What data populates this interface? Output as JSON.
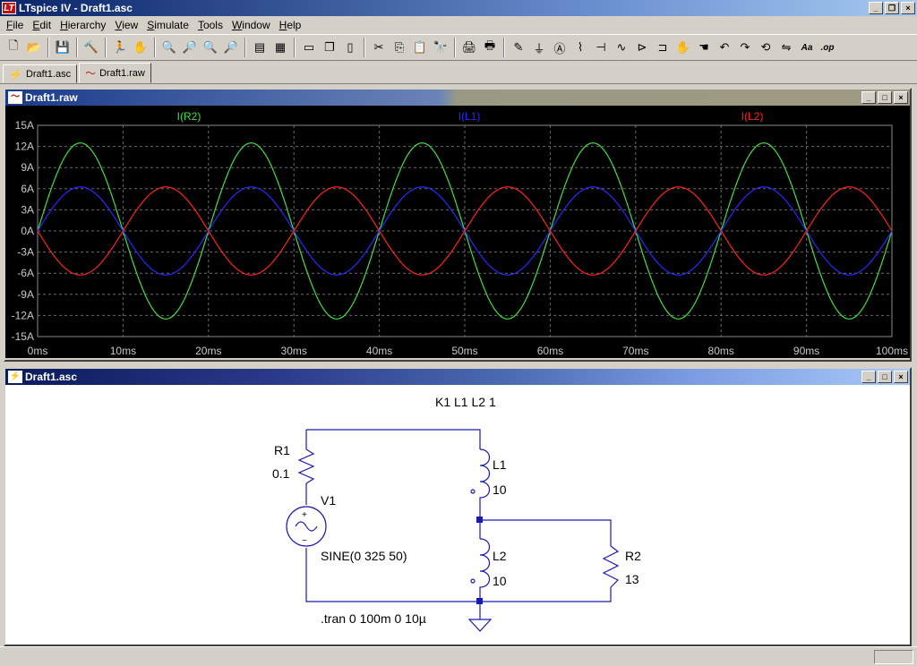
{
  "app": {
    "title": "LTspice IV - Draft1.asc",
    "icon_name": "ltspice-logo-icon"
  },
  "window_controls": [
    "_",
    "❐",
    "×"
  ],
  "menu": [
    {
      "label": "File",
      "ul": "F",
      "rest": "ile"
    },
    {
      "label": "Edit",
      "ul": "E",
      "rest": "dit"
    },
    {
      "label": "Hierarchy",
      "ul": "H",
      "rest": "ierarchy"
    },
    {
      "label": "View",
      "ul": "V",
      "rest": "iew"
    },
    {
      "label": "Simulate",
      "ul": "S",
      "rest": "imulate"
    },
    {
      "label": "Tools",
      "ul": "T",
      "rest": "ools"
    },
    {
      "label": "Window",
      "ul": "W",
      "rest": "indow"
    },
    {
      "label": "Help",
      "ul": "H",
      "rest": "elp"
    }
  ],
  "toolbar": [
    {
      "icon": "new-schematic-icon",
      "glyph": "🗋"
    },
    {
      "icon": "open-icon",
      "glyph": "📂"
    },
    {
      "sep": true
    },
    {
      "icon": "save-icon",
      "glyph": "💾"
    },
    {
      "sep": true
    },
    {
      "icon": "control-panel-icon",
      "glyph": "🔨"
    },
    {
      "sep": true
    },
    {
      "icon": "run-icon",
      "glyph": "🏃"
    },
    {
      "icon": "halt-icon",
      "glyph": "✋"
    },
    {
      "sep": true
    },
    {
      "icon": "zoom-in-icon",
      "glyph": "🔍"
    },
    {
      "icon": "pan-icon",
      "glyph": "🔎"
    },
    {
      "icon": "zoom-out-icon",
      "glyph": "🔍"
    },
    {
      "icon": "zoom-fit-icon",
      "glyph": "🔎"
    },
    {
      "sep": true
    },
    {
      "icon": "autorange-icon",
      "glyph": "▤"
    },
    {
      "icon": "grid-icon",
      "glyph": "▦"
    },
    {
      "sep": true
    },
    {
      "icon": "tile-horizontal-icon",
      "glyph": "▭"
    },
    {
      "icon": "cascade-icon",
      "glyph": "❐"
    },
    {
      "icon": "tile-vertical-icon",
      "glyph": "▯"
    },
    {
      "sep": true
    },
    {
      "icon": "cut-icon",
      "glyph": "✂"
    },
    {
      "icon": "copy-icon",
      "glyph": "⎘"
    },
    {
      "icon": "paste-icon",
      "glyph": "📋"
    },
    {
      "icon": "find-icon",
      "glyph": "🔭"
    },
    {
      "sep": true
    },
    {
      "icon": "print-setup-icon",
      "glyph": "🖨"
    },
    {
      "icon": "print-icon",
      "glyph": "🖶"
    },
    {
      "sep": true
    },
    {
      "icon": "wire-icon",
      "glyph": "✎"
    },
    {
      "icon": "ground-icon",
      "glyph": "⏚"
    },
    {
      "icon": "label-net-icon",
      "glyph": "Ⓐ"
    },
    {
      "icon": "resistor-icon",
      "glyph": "⌇"
    },
    {
      "icon": "capacitor-icon",
      "glyph": "⊣"
    },
    {
      "icon": "inductor-icon",
      "glyph": "∿"
    },
    {
      "icon": "diode-icon",
      "glyph": "⊳"
    },
    {
      "icon": "component-icon",
      "glyph": "⊐"
    },
    {
      "icon": "move-icon",
      "glyph": "✋"
    },
    {
      "icon": "drag-icon",
      "glyph": "☚"
    },
    {
      "icon": "undo-icon",
      "glyph": "↶"
    },
    {
      "icon": "redo-icon",
      "glyph": "↷"
    },
    {
      "icon": "rotate-icon",
      "glyph": "⟲"
    },
    {
      "icon": "mirror-icon",
      "glyph": "⇋"
    },
    {
      "icon": "text-icon",
      "glyph": "Aa"
    },
    {
      "icon": "spice-directive-icon",
      "glyph": ".op"
    }
  ],
  "tabs": [
    {
      "label": "Draft1.asc",
      "icon": "schematic-icon"
    },
    {
      "label": "Draft1.raw",
      "icon": "waveform-icon"
    }
  ],
  "plot_window": {
    "title": "Draft1.raw"
  },
  "schematic_window": {
    "title": "Draft1.asc"
  },
  "chart_data": {
    "type": "line",
    "x_unit": "ms",
    "xlim": [
      0,
      100
    ],
    "ylim": [
      -15,
      15
    ],
    "x_ticks": [
      "0ms",
      "10ms",
      "20ms",
      "30ms",
      "40ms",
      "50ms",
      "60ms",
      "70ms",
      "80ms",
      "90ms",
      "100ms"
    ],
    "y_ticks": [
      "15A",
      "12A",
      "9A",
      "6A",
      "3A",
      "0A",
      "-3A",
      "-6A",
      "-9A",
      "-12A",
      "-15A"
    ],
    "grid": true,
    "series": [
      {
        "name": "I(R2)",
        "color": "#40e040",
        "amplitude": 12.5,
        "frequency_hz": 50,
        "phase": "sine"
      },
      {
        "name": "I(L1)",
        "color": "#2828ff",
        "amplitude": 6.25,
        "frequency_hz": 50,
        "phase": "sine"
      },
      {
        "name": "I(L2)",
        "color": "#ff2020",
        "amplitude": 6.25,
        "frequency_hz": 50,
        "phase": "inverted-sine"
      }
    ]
  },
  "schematic": {
    "coupling": "K1 L1 L2 1",
    "r1_name": "R1",
    "r1_value": "0.1",
    "v1_name": "V1",
    "v1_value": "SINE(0 325 50)",
    "l1_name": "L1",
    "l1_value": "10",
    "l2_name": "L2",
    "l2_value": "10",
    "r2_name": "R2",
    "r2_value": "13",
    "directive": ".tran 0 100m 0 10µ",
    "plus": "+",
    "minus": "−"
  }
}
